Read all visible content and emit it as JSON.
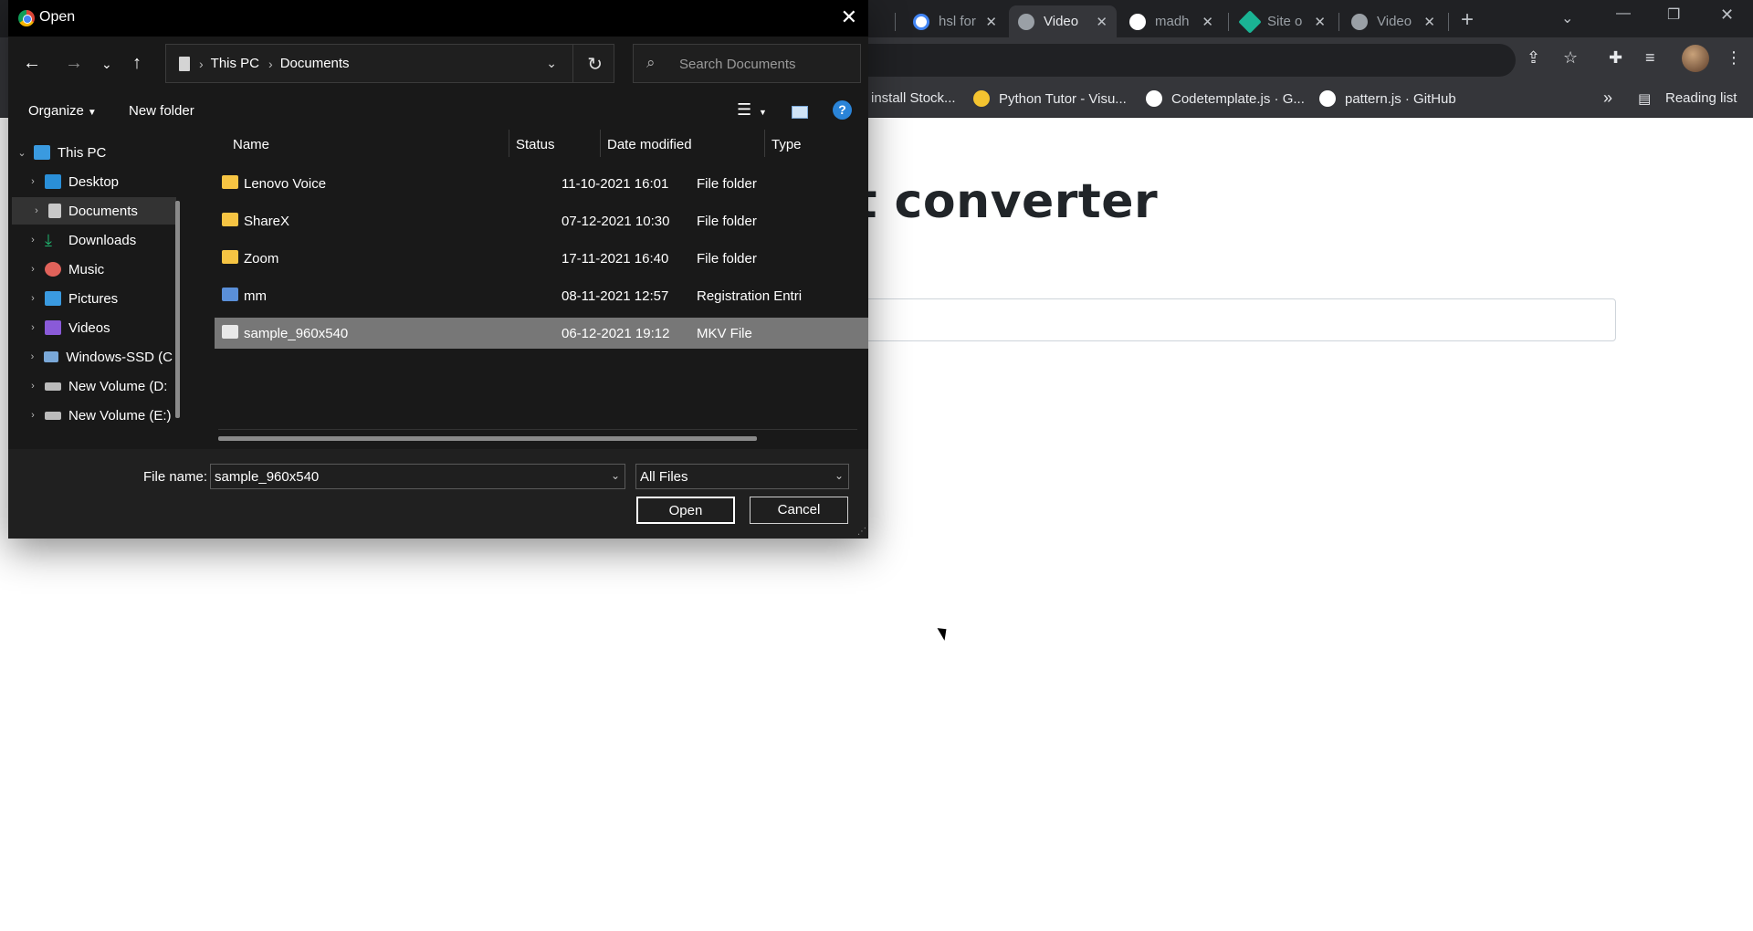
{
  "browser": {
    "tabs": [
      {
        "label": "hsl for",
        "color": "#4285f4"
      },
      {
        "label": "Video",
        "color": "#9aa0a6"
      },
      {
        "label": "madh",
        "color": "#ffffff"
      },
      {
        "label": "Site o",
        "color": "#1ab394"
      },
      {
        "label": "Video",
        "color": "#9aa0a6"
      }
    ],
    "new_tab": "+",
    "bookmarks": [
      {
        "label": "install Stock...",
        "color": "#4285f4"
      },
      {
        "label": "Python Tutor - Visu...",
        "color": "#f4c430"
      },
      {
        "label": "Codetemplate.js · G...",
        "color": "#ffffff"
      },
      {
        "label": "pattern.js · GitHub",
        "color": "#ffffff"
      }
    ],
    "more_bookmarks": "»",
    "reading_list": "Reading list"
  },
  "page": {
    "title": "at converter"
  },
  "dialog": {
    "title": "Open",
    "breadcrumb": [
      "This PC",
      "Documents"
    ],
    "search_placeholder": "Search Documents",
    "organize": "Organize",
    "new_folder": "New folder",
    "help": "?",
    "tree": [
      {
        "label": "This PC",
        "icon_color": "#3a9ae0",
        "expanded": true
      },
      {
        "label": "Desktop",
        "icon_color": "#2a8fd8"
      },
      {
        "label": "Documents",
        "icon_color": "#c8c8c8",
        "selected": true
      },
      {
        "label": "Downloads",
        "icon_color": "#1fb56f"
      },
      {
        "label": "Music",
        "icon_color": "#e0625a"
      },
      {
        "label": "Pictures",
        "icon_color": "#3a9ae0"
      },
      {
        "label": "Videos",
        "icon_color": "#8a5ad8"
      },
      {
        "label": "Windows-SSD (C",
        "icon_color": "#7aa8d8"
      },
      {
        "label": "New Volume (D:",
        "icon_color": "#bbbbbb"
      },
      {
        "label": "New Volume (E:)",
        "icon_color": "#bbbbbb"
      }
    ],
    "columns": [
      "Name",
      "Status",
      "Date modified",
      "Type"
    ],
    "files": [
      {
        "name": "Lenovo Voice",
        "date": "11-10-2021 16:01",
        "type": "File folder",
        "kind": "folder"
      },
      {
        "name": "ShareX",
        "date": "07-12-2021 10:30",
        "type": "File folder",
        "kind": "folder"
      },
      {
        "name": "Zoom",
        "date": "17-11-2021 16:40",
        "type": "File folder",
        "kind": "folder"
      },
      {
        "name": "mm",
        "date": "08-11-2021 12:57",
        "type": "Registration Entri",
        "kind": "regf"
      },
      {
        "name": "sample_960x540",
        "date": "06-12-2021 19:12",
        "type": "MKV File",
        "kind": "file",
        "selected": true
      }
    ],
    "file_name_label": "File name:",
    "file_name_value": "sample_960x540",
    "file_type_value": "All Files",
    "open_button": "Open",
    "cancel_button": "Cancel"
  }
}
